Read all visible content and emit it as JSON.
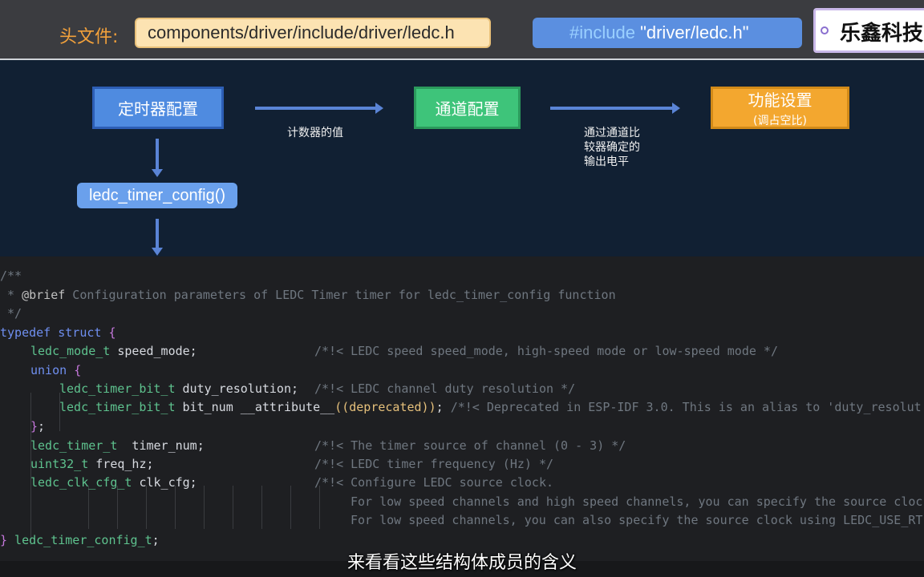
{
  "header": {
    "label": "头文件:",
    "path": "components/driver/include/driver/ledc.h",
    "include_keyword": "#include",
    "include_file": " \"driver/ledc.h\"",
    "brand": "乐鑫科技"
  },
  "diagram": {
    "timer_node": "定时器配置",
    "channel_node": "通道配置",
    "function_node": "功能设置",
    "function_sub": "(调占空比)",
    "call_node": "ledc_timer_config()",
    "edge_timer_channel": "计数器的值",
    "edge_channel_function": [
      "通过通道比",
      "较器确定的",
      "输出电平"
    ]
  },
  "code": {
    "l1": "/**",
    "l2_prefix": " * ",
    "l2_tag": "@brief",
    "l2_text": " Configuration parameters of LEDC Timer timer for ledc_timer_config function",
    "l3": " */",
    "l4_kw": "typedef struct ",
    "l4_brace": "{",
    "l5_type": "ledc_mode_t",
    "l5_name": " speed_mode;",
    "l5_comment": "/*!< LEDC speed speed_mode, high-speed mode or low-speed mode */",
    "l6_kw": "union ",
    "l6_brace": "{",
    "l7_type": "ledc_timer_bit_t",
    "l7_name": " duty_resolution;",
    "l7_comment": "/*!< LEDC channel duty resolution */",
    "l8_type": "ledc_timer_bit_t",
    "l8_name": " bit_num __attribute__",
    "l8_paren": "((deprecated))",
    "l8_end": "; ",
    "l8_comment": "/*!< Deprecated in ESP-IDF 3.0. This is an alias to 'duty_resolut",
    "l9_brace": "}",
    "l9_end": ";",
    "l10_type": "ledc_timer_t",
    "l10_name": "  timer_num;",
    "l10_comment": "/*!< The timer source of channel (0 - 3) */",
    "l11_type": "uint32_t",
    "l11_name": " freq_hz;",
    "l11_comment": "/*!< LEDC timer frequency (Hz) */",
    "l12_type": "ledc_clk_cfg_t",
    "l12_name": " clk_cfg;",
    "l12_comment": "/*!< Configure LEDC source clock.",
    "l13_comment": "For low speed channels and high speed channels, you can specify the source cloc",
    "l14_comment": "For low speed channels, you can also specify the source clock using LEDC_USE_RT",
    "l15_brace": "}",
    "l15_type": " ledc_timer_config_t",
    "l15_end": ";"
  },
  "subtitle": "来看看这些结构体成员的含义"
}
